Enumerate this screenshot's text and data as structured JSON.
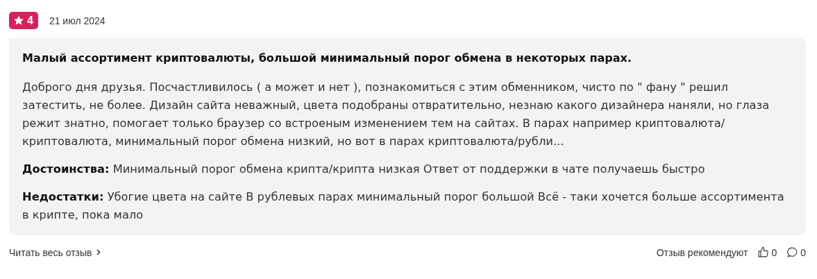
{
  "rating": {
    "value": "4"
  },
  "date": "21 июл 2024",
  "review": {
    "title": "Малый ассортимент криптовалюты, большой минимальный порог обмена в некоторых парах.",
    "text": "Доброго дня друзья. Посчастливилось ( а может и нет ), познакомиться с этим обменником, чисто по \" фану \" решил затестить, не более. Дизайн сайта неважный, цвета подобраны отвратительно, незнаю какого дизайнера наняли, но глаза режит знатно, помогает только браузер со встроеным изменением тем на сайтах. В парах например криптовалюта/криптовалюта, минимальный порог обмена низкий, но вот в парах криптовалюта/рубли...",
    "pros": "**Достоинства:** Минимальный порог обмена крипта/крипта низкая Ответ от поддержки в чате получаешь быстро",
    "cons": "**Недостатки:** Убогие цвета на сайте В рублевых парах минимальный порог большой Всё - таки хочется больше ассортимента в крипте, пока мало"
  },
  "footer": {
    "read_more": "Читать весь отзыв",
    "recommend_label": "Отзыв рекомендуют",
    "likes": "0",
    "comments": "0"
  }
}
